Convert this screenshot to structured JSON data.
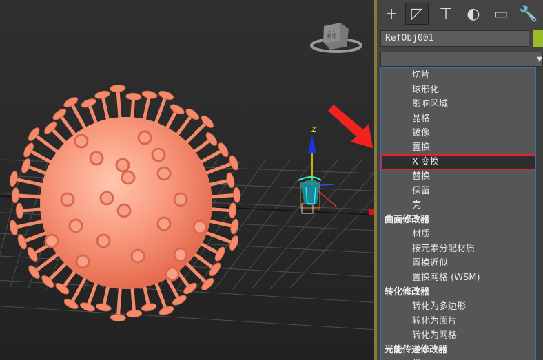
{
  "viewport": {
    "viewcube_label": "前",
    "gizmo_axis_label": "Z"
  },
  "toolbar": {
    "buttons": [
      {
        "name": "create-icon",
        "glyph": "+"
      },
      {
        "name": "modify-icon",
        "glyph": "◸"
      },
      {
        "name": "hierarchy-icon",
        "glyph": "⊤"
      },
      {
        "name": "motion-icon",
        "glyph": "◐"
      },
      {
        "name": "display-icon",
        "glyph": "▭"
      },
      {
        "name": "utilities-icon",
        "glyph": "🔧"
      }
    ],
    "active_index": 1
  },
  "object": {
    "name": "RefObj001",
    "color": "#9cbb2a"
  },
  "modifier_list": {
    "rows": [
      {
        "type": "item",
        "label": "切片"
      },
      {
        "type": "item",
        "label": "球形化"
      },
      {
        "type": "item",
        "label": "影响区域"
      },
      {
        "type": "item",
        "label": "晶格"
      },
      {
        "type": "item",
        "label": "镜像"
      },
      {
        "type": "item",
        "label": "置换"
      },
      {
        "type": "item",
        "label": "X 变换",
        "selected": true
      },
      {
        "type": "item",
        "label": "替换"
      },
      {
        "type": "item",
        "label": "保留"
      },
      {
        "type": "item",
        "label": "壳"
      },
      {
        "type": "category",
        "label": "曲面修改器"
      },
      {
        "type": "item",
        "label": "材质"
      },
      {
        "type": "item",
        "label": "按元素分配材质"
      },
      {
        "type": "item",
        "label": "置换近似"
      },
      {
        "type": "item",
        "label": "置换网格 (WSM)"
      },
      {
        "type": "category",
        "label": "转化修改器"
      },
      {
        "type": "item",
        "label": "转化为多边形"
      },
      {
        "type": "item",
        "label": "转化为面片"
      },
      {
        "type": "item",
        "label": "转化为网格"
      },
      {
        "type": "category",
        "label": "光能传递修改器"
      },
      {
        "type": "item",
        "label": "细分"
      }
    ]
  },
  "colors": {
    "accent_red": "#e0242a",
    "virus": "#f08a6a",
    "list_border": "#3c6fb0"
  }
}
